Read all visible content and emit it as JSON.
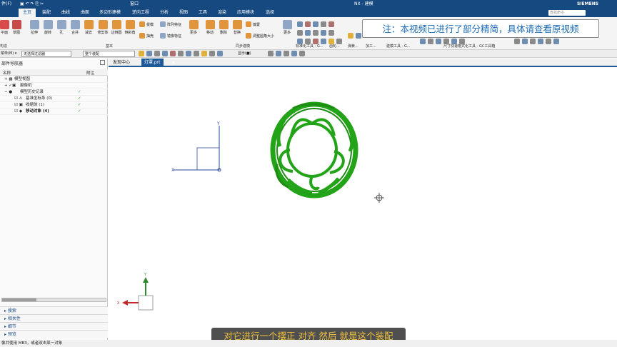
{
  "title_bar": {
    "left_label": "件(F)",
    "window_label": "窗口",
    "title": "NX - 建模",
    "search_placeholder": "查找命令",
    "brand": "SIEMENS"
  },
  "tabs": [
    "主页",
    "装配",
    "曲线",
    "曲面",
    "多边形建模",
    "逆向工程",
    "分析",
    "视图",
    "工具",
    "渲染",
    "应用模块",
    "选择"
  ],
  "active_tab": "主页",
  "ribbon": {
    "buttons": [
      "平面",
      "草图",
      "拉伸",
      "旋转",
      "孔",
      "合并",
      "减去",
      "修剪体",
      "边倒圆",
      "倒斜角",
      "更多",
      "移动",
      "删除",
      "替换",
      "更多"
    ],
    "small_buttons": [
      "拔模",
      "阵列特征",
      "抽壳",
      "镜像特征",
      "偏置",
      "调整圆角大小"
    ],
    "groups": [
      "构造",
      "基本",
      "同步建模",
      "标准化工具 - G...",
      "齿轮...",
      "弹簧...",
      "加工...",
      "建模工具 - G...",
      "尺寸快速格式化工具 - GC工具箱"
    ]
  },
  "notice": "注：本视频已进行了部分精简，具体请查看原视频",
  "selection_bar": {
    "prefix": "菜单(M) ▾",
    "filter": "无选择过滤器",
    "scope": "整个装配",
    "snap": "显示(■)"
  },
  "file_tabs": [
    "发现中心",
    "灯罩.prt"
  ],
  "active_file": "灯罩.prt",
  "navigator": {
    "title": "部件导航器",
    "columns": [
      "名称",
      "附注"
    ],
    "rows": [
      {
        "name": "模型视图",
        "check": false
      },
      {
        "name": "摄像机",
        "check": false
      },
      {
        "name": "模型历史记录",
        "check": true
      },
      {
        "name": "基准坐标系 (0)",
        "check": true
      },
      {
        "name": "收缩体 (1)",
        "check": true
      },
      {
        "name": "移动对象 (4)",
        "check": true
      }
    ],
    "sections": [
      "搜索",
      "相关性",
      "细节",
      "预览"
    ]
  },
  "axis_labels": {
    "y": "Y",
    "x": "X"
  },
  "status_text": "像并使用 MB3，或者双击某一对象",
  "subtitle": "对它进行一个摆正 对齐 然后 就是这个装配",
  "colors": {
    "title_bg": "#16497f",
    "model_green": "#23a317",
    "notice_text": "#1b6ab3",
    "subtitle_text": "#f0c040"
  }
}
